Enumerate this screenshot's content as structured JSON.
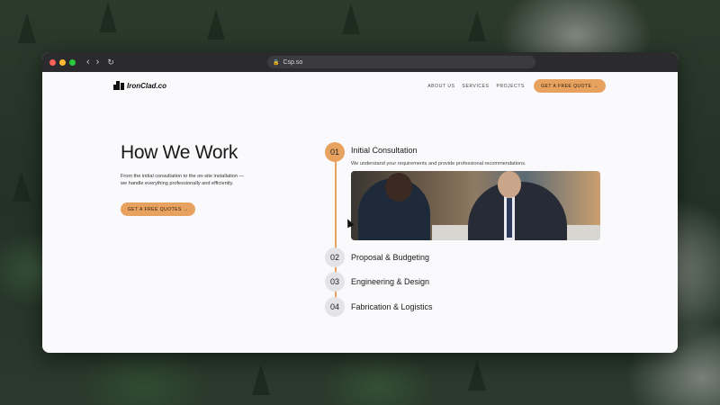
{
  "browser": {
    "url": "Csp.so",
    "traffic_colors": [
      "#ff5f57",
      "#febc2e",
      "#28c840"
    ],
    "back_icon": "chevron-left-icon",
    "forward_icon": "chevron-right-icon",
    "reload_icon": "reload-icon"
  },
  "site": {
    "brand": "IronClad.co",
    "nav": {
      "about": "ABOUT US",
      "services": "SERVICES",
      "projects": "PROJECTS",
      "cta": "GET A FREE QUOTE →"
    },
    "accent_color": "#e8a25f"
  },
  "hero": {
    "title": "How We Work",
    "intro": "From the initial consultation to the on-site installation — we handle everything professionally and efficiently.",
    "cta": "GET A FREE QUOTES →"
  },
  "steps": [
    {
      "num": "01",
      "title": "Initial Consultation",
      "description": "We understand your requirements and provide professional recommendations.",
      "active": true
    },
    {
      "num": "02",
      "title": "Proposal & Budgeting",
      "active": false
    },
    {
      "num": "03",
      "title": "Engineering & Design",
      "active": false
    },
    {
      "num": "04",
      "title": "Fabrication & Logistics",
      "active": false
    }
  ]
}
